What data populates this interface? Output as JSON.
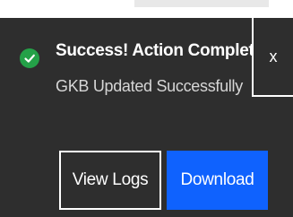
{
  "notification": {
    "title": "Success! Action Completed",
    "subtitle": "GKB Updated Successfully",
    "status_icon": "checkmark-circle-icon",
    "close_label": "x",
    "close_icon": "close-icon"
  },
  "actions": {
    "secondary_label": "View Logs",
    "primary_label": "Download"
  },
  "colors": {
    "background": "#2e2e2e",
    "success": "#24a148",
    "primary": "#0f62fe",
    "text": "#ffffff",
    "subtext": "#d6d6d6"
  }
}
